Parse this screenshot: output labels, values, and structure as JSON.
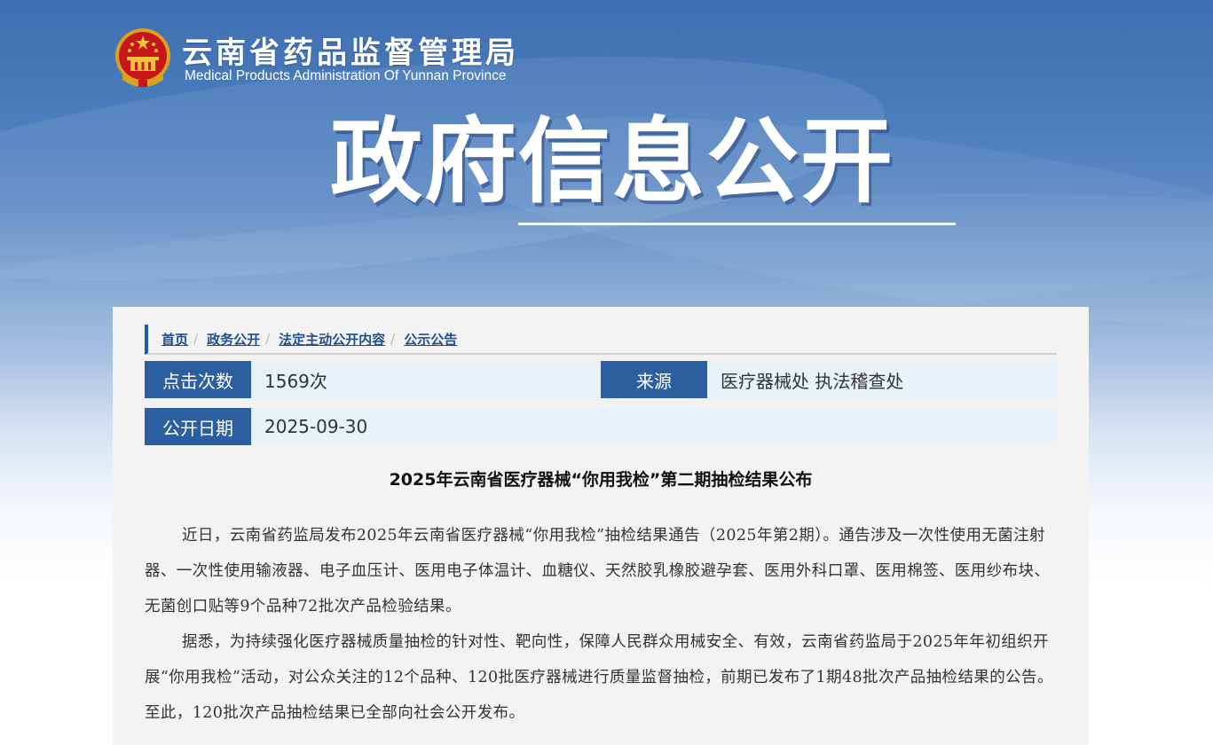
{
  "site": {
    "name_cn": "云南省药品监督管理局",
    "name_en": "Medical Products Administration Of Yunnan Province"
  },
  "banner": {
    "title": "政府信息公开"
  },
  "breadcrumb": [
    {
      "label": "首页"
    },
    {
      "label": "政务公开"
    },
    {
      "label": "法定主动公开内容"
    },
    {
      "label": "公示公告"
    }
  ],
  "meta": {
    "clicks_label": "点击次数",
    "clicks_value": "1569次",
    "source_label": "来源",
    "source_value": "医疗器械处 执法稽查处",
    "date_label": "公开日期",
    "date_value": "2025-09-30"
  },
  "article": {
    "title": "2025年云南省医疗器械“你用我检”第二期抽检结果公布",
    "paragraphs": [
      "近日，云南省药监局发布2025年云南省医疗器械“你用我检”抽检结果通告（2025年第2期）。通告涉及一次性使用无菌注射器、一次性使用输液器、电子血压计、医用电子体温计、血糖仪、天然胶乳橡胶避孕套、医用外科口罩、医用棉签、医用纱布块、无菌创口贴等9个品种72批次产品检验结果。",
      "据悉，为持续强化医疗器械质量抽检的针对性、靶向性，保障人民群众用械安全、有效，云南省药监局于2025年年初组织开展“你用我检”活动，对公众关注的12个品种、120批医疗器械进行质量监督抽检，前期已发布了1期48批次产品抽检结果的公告。至此，120批次产品抽检结果已全部向社会公开发布。"
    ]
  },
  "colors": {
    "label_bg": "#2c5f9f",
    "row_bg": "#e8f2fb",
    "link": "#1f4e8f",
    "accent_bar": "#1f5aa6"
  },
  "icons": {
    "emblem": "national-emblem-icon"
  }
}
